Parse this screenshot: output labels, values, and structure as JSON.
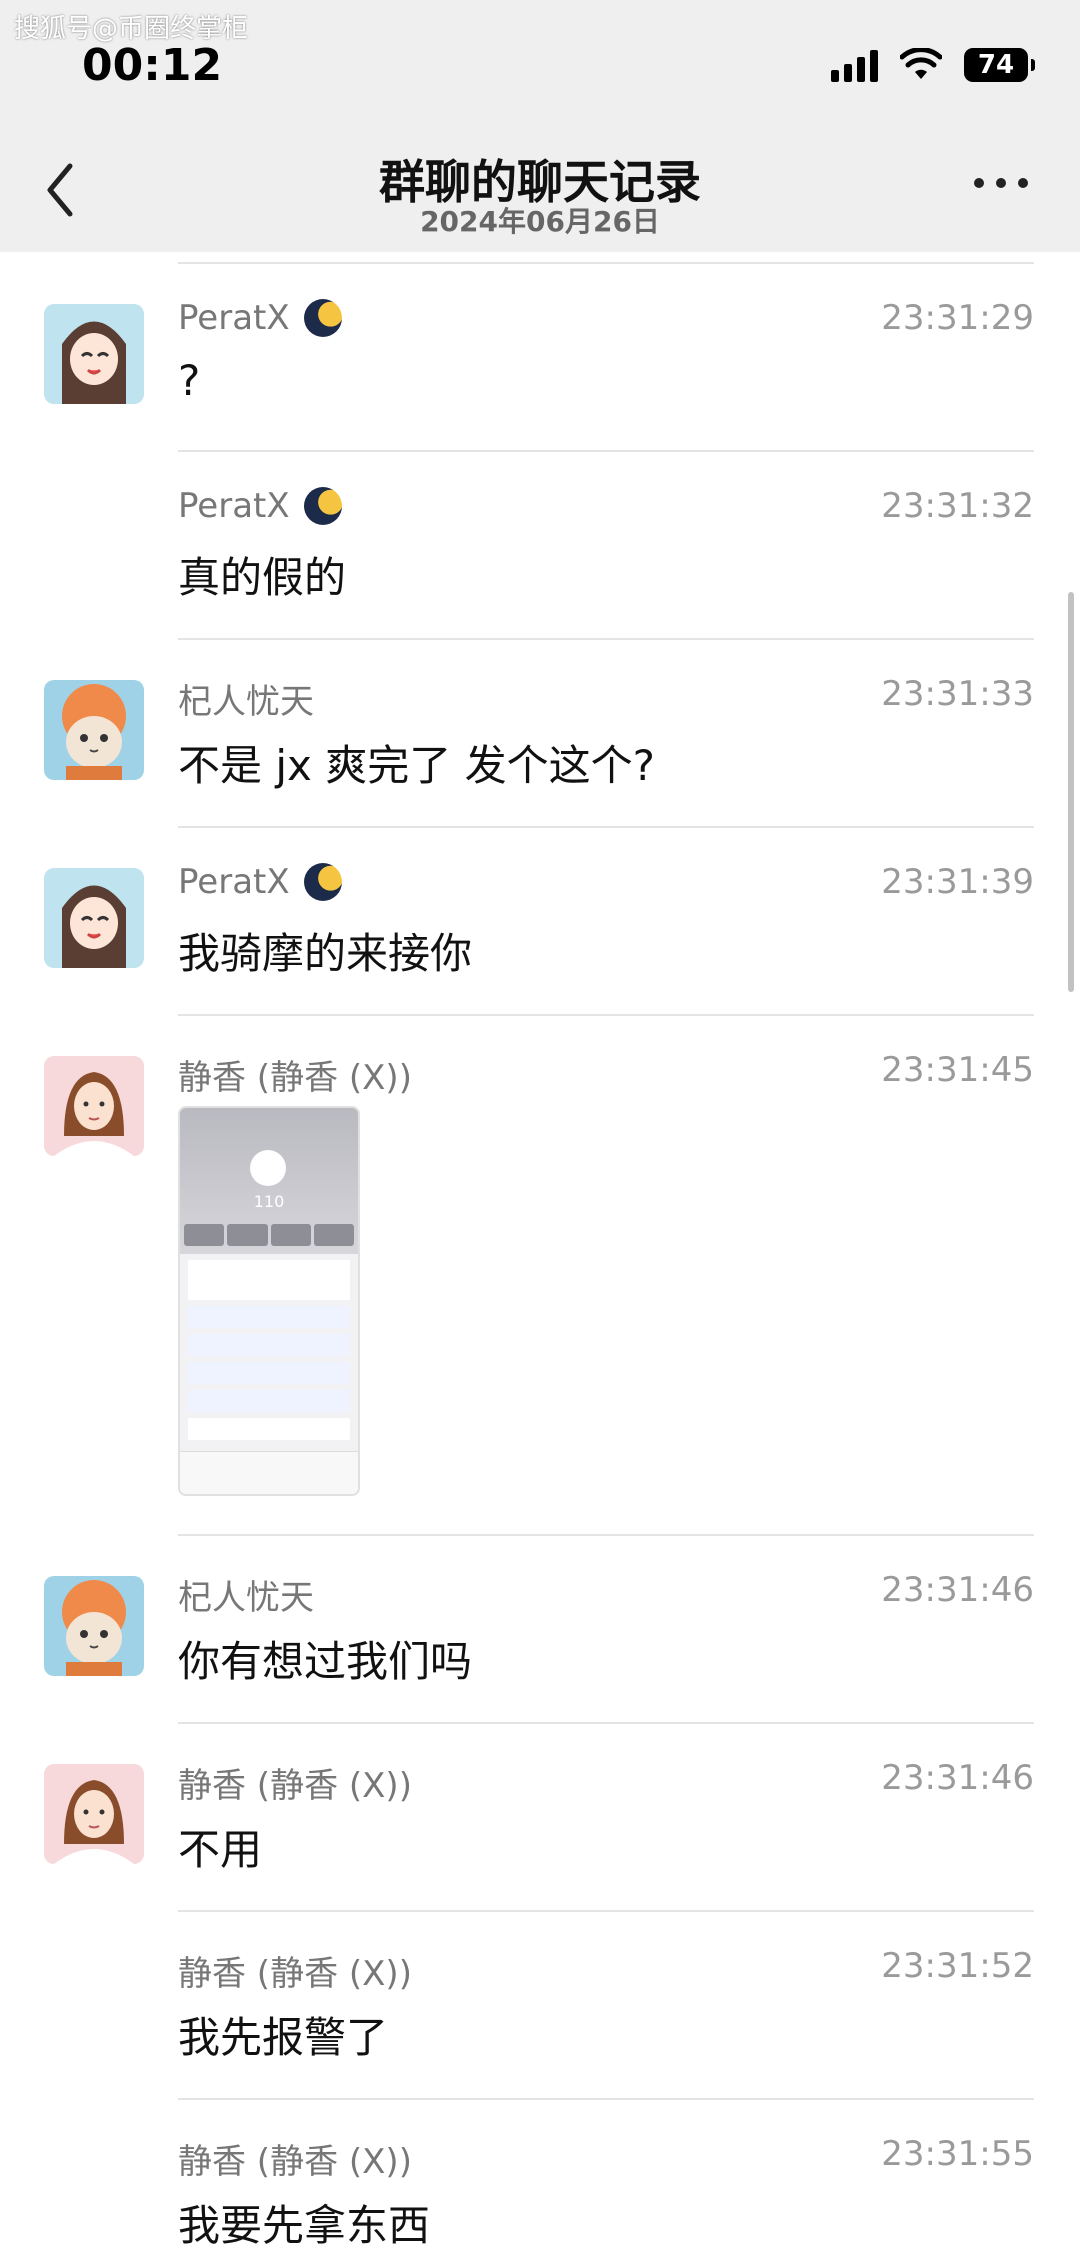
{
  "watermark": "搜狐号@币圈终掌柜",
  "status_bar": {
    "time": "00:12",
    "battery": "74"
  },
  "header": {
    "title": "群聊的聊天记录",
    "subtitle": "2024年06月26日"
  },
  "messages": [
    {
      "sender": "PeratX",
      "badge": "moon-icon",
      "time": "23:31:29",
      "text": "?",
      "avatar": "anime-girl"
    },
    {
      "sender": "PeratX",
      "badge": "moon-icon",
      "time": "23:31:32",
      "text": "真的假的",
      "avatar": ""
    },
    {
      "sender": "杞人忧天",
      "time": "23:31:33",
      "text": "不是 jx 爽完了 发个这个?",
      "avatar": "cat"
    },
    {
      "sender": "PeratX",
      "badge": "moon-icon",
      "time": "23:31:39",
      "text": "我骑摩的来接你",
      "avatar": "anime-girl"
    },
    {
      "sender": "静香 (静香 (X))",
      "time": "23:31:45",
      "image": {
        "caption_number": "110"
      },
      "avatar": "shizuka"
    },
    {
      "sender": "杞人忧天",
      "time": "23:31:46",
      "text": "你有想过我们吗",
      "avatar": "cat"
    },
    {
      "sender": "静香 (静香 (X))",
      "time": "23:31:46",
      "text": "不用",
      "avatar": "shizuka"
    },
    {
      "sender": "静香 (静香 (X))",
      "time": "23:31:52",
      "text": "我先报警了",
      "avatar": ""
    },
    {
      "sender": "静香 (静香 (X))",
      "time": "23:31:55",
      "text": "我要先拿东西",
      "avatar": ""
    }
  ]
}
